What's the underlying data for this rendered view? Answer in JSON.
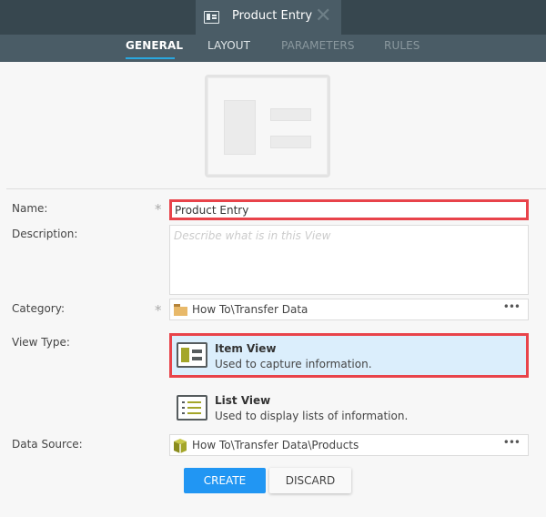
{
  "window": {
    "doc_tab_title": "Product Entry",
    "doc_tab_icon": "item-view-icon",
    "close_icon": "close-icon"
  },
  "tabs": [
    {
      "label": "GENERAL",
      "state": "active"
    },
    {
      "label": "LAYOUT",
      "state": "normal"
    },
    {
      "label": "PARAMETERS",
      "state": "disabled"
    },
    {
      "label": "RULES",
      "state": "disabled"
    }
  ],
  "form": {
    "name_label": "Name:",
    "name_value": "Product Entry",
    "description_label": "Description:",
    "description_value": "",
    "description_placeholder": "Describe what is in this View",
    "category_label": "Category:",
    "category_value": "How To\\Transfer Data",
    "category_icon": "folder-icon",
    "view_type_label": "View Type:",
    "view_types": [
      {
        "title": "Item View",
        "description": "Used to capture information.",
        "icon": "item-view-icon",
        "selected": true
      },
      {
        "title": "List View",
        "description": "Used to display lists of information.",
        "icon": "list-view-icon",
        "selected": false
      }
    ],
    "data_source_label": "Data Source:",
    "data_source_value": "How To\\Transfer Data\\Products",
    "data_source_icon": "smartobject-box-icon",
    "picker_button_label": "•••",
    "required_marker": "*"
  },
  "actions": {
    "create_label": "CREATE",
    "discard_label": "DISCARD"
  },
  "colors": {
    "accent": "#2196f3",
    "highlight_border": "#e8434a",
    "selected_bg": "#dbeefc",
    "tab_underline": "#29a8e0",
    "olive_icon": "#a4a62a"
  }
}
